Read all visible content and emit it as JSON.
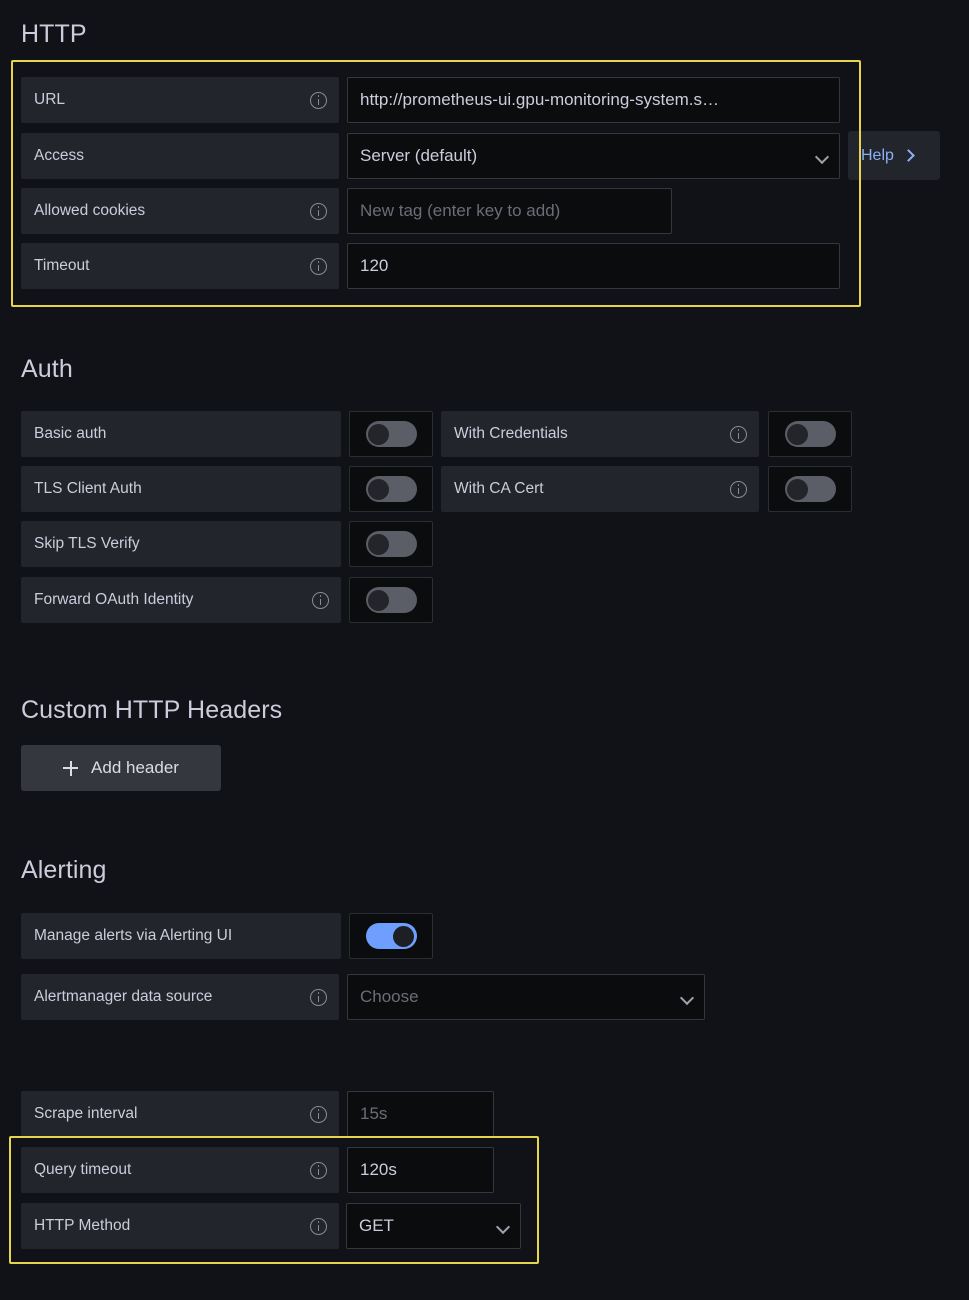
{
  "sections": {
    "http": {
      "title": "HTTP",
      "fields": {
        "url": {
          "label": "URL",
          "value": "http://prometheus-ui.gpu-monitoring-system.s…",
          "info": "info-icon"
        },
        "access": {
          "label": "Access",
          "value": "Server (default)",
          "info": ""
        },
        "allowed_cookies": {
          "label": "Allowed cookies",
          "placeholder": "New tag (enter key to add)",
          "info": "info-icon"
        },
        "timeout": {
          "label": "Timeout",
          "value": "120",
          "info": "info-icon"
        }
      },
      "help_label": "Help"
    },
    "auth": {
      "title": "Auth",
      "left_items": [
        {
          "label": "Basic auth",
          "has_info": false,
          "enabled": false
        },
        {
          "label": "TLS Client Auth",
          "has_info": false,
          "enabled": false
        },
        {
          "label": "Skip TLS Verify",
          "has_info": false,
          "enabled": false
        },
        {
          "label": "Forward OAuth Identity",
          "has_info": true,
          "enabled": false
        }
      ],
      "right_items": [
        {
          "label": "With Credentials",
          "has_info": true,
          "enabled": false
        },
        {
          "label": "With CA Cert",
          "has_info": true,
          "enabled": false
        }
      ]
    },
    "custom_headers": {
      "title": "Custom HTTP Headers",
      "add_header_label": "Add header"
    },
    "alerting": {
      "title": "Alerting",
      "manage_alerts": {
        "label": "Manage alerts via Alerting UI",
        "enabled": true
      },
      "alertmanager": {
        "label": "Alertmanager data source",
        "placeholder": "Choose"
      }
    },
    "misc": {
      "scrape_interval": {
        "label": "Scrape interval",
        "placeholder": "15s"
      },
      "query_timeout": {
        "label": "Query timeout",
        "value": "120s"
      },
      "http_method": {
        "label": "HTTP Method",
        "value": "GET"
      }
    }
  },
  "colors": {
    "background": "#111217",
    "label_background": "#22252b",
    "input_background": "#0b0c0e",
    "text": "#ccccdc",
    "placeholder": "#6a6d78",
    "accent_blue": "#6e9fff",
    "link_blue": "#8ab0f8",
    "highlight_yellow": "#e6d44a"
  }
}
